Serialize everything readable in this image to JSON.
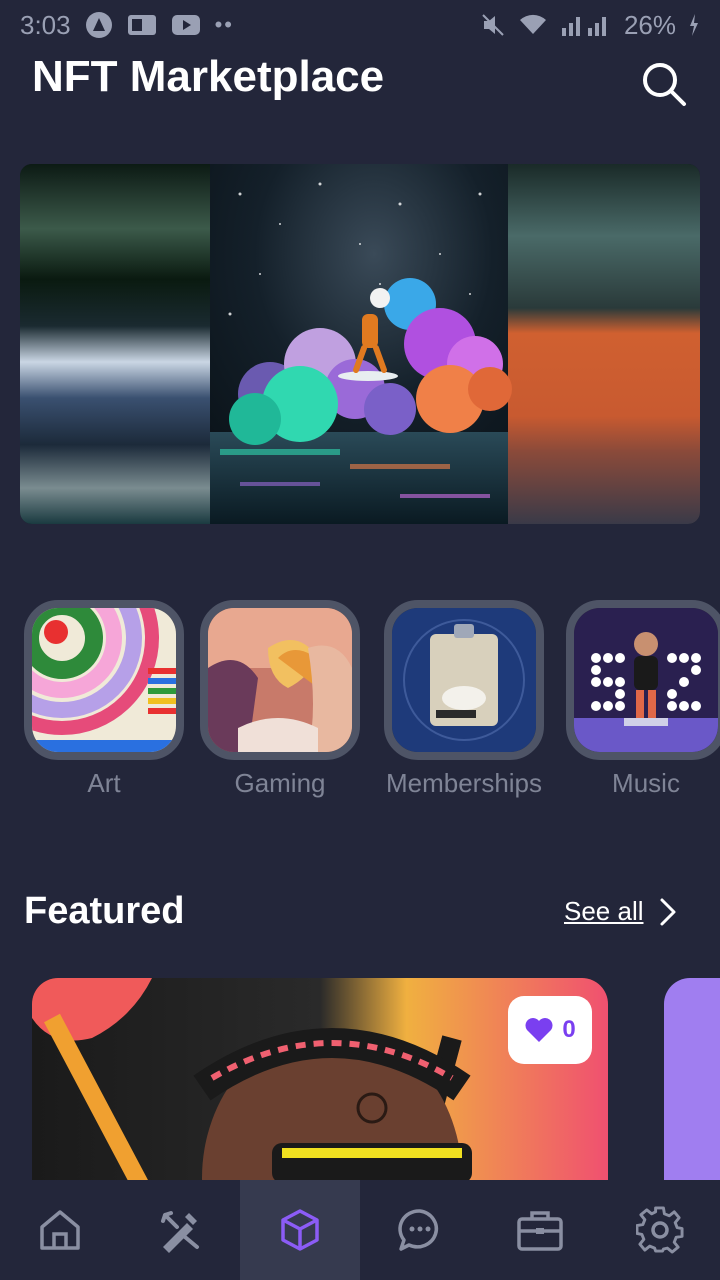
{
  "status_bar": {
    "time": "3:03",
    "battery": "26%"
  },
  "header": {
    "title": "NFT Marketplace",
    "search_icon": "search-icon"
  },
  "categories": [
    {
      "label": "Art"
    },
    {
      "label": "Gaming"
    },
    {
      "label": "Memberships"
    },
    {
      "label": "Music"
    }
  ],
  "featured": {
    "title": "Featured",
    "see_all": "See all",
    "card": {
      "likes": "0"
    }
  },
  "bottom_nav": {
    "items": [
      {
        "icon": "home-icon"
      },
      {
        "icon": "create-icon"
      },
      {
        "icon": "cube-icon",
        "active": true
      },
      {
        "icon": "chat-icon"
      },
      {
        "icon": "briefcase-icon"
      },
      {
        "icon": "settings-icon"
      }
    ]
  },
  "colors": {
    "background": "#23263a",
    "accent": "#7a3ff0",
    "muted_text": "#7f8496",
    "nav_active": "#363a4f"
  }
}
